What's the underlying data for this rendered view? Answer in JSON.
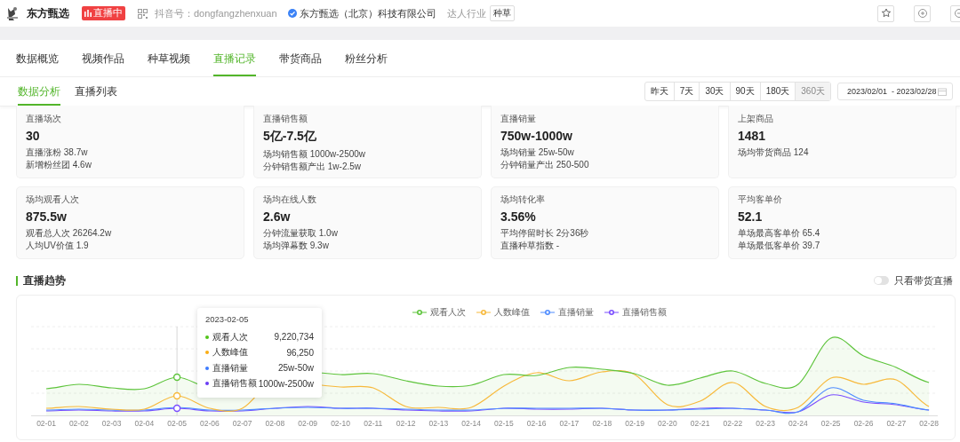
{
  "header": {
    "name": "东方甄选",
    "live_badge": "直播中",
    "douyin_id": "抖音号：dongfangzhenxuan",
    "company": "东方甄选（北京）科技有限公司",
    "industry_label": "达人行业",
    "industry_tag": "种草"
  },
  "tabs": [
    {
      "label": "数据概览",
      "selected": false
    },
    {
      "label": "视频作品",
      "selected": false
    },
    {
      "label": "种草视频",
      "selected": false
    },
    {
      "label": "直播记录",
      "selected": true
    },
    {
      "label": "带货商品",
      "selected": false
    },
    {
      "label": "粉丝分析",
      "selected": false
    }
  ],
  "subtabs": [
    {
      "label": "数据分析",
      "selected": true
    },
    {
      "label": "直播列表",
      "selected": false
    }
  ],
  "periods": [
    {
      "label": "昨天",
      "selected": false
    },
    {
      "label": "7天",
      "selected": false
    },
    {
      "label": "30天",
      "selected": false
    },
    {
      "label": "90天",
      "selected": false
    },
    {
      "label": "180天",
      "selected": false
    },
    {
      "label": "360天",
      "selected": true
    }
  ],
  "date_range": "2023/02/01  - 2023/02/28",
  "metrics": [
    {
      "title": "直播场次",
      "value": "30",
      "details": [
        "直播涨粉 38.7w",
        "新增粉丝团 4.6w"
      ]
    },
    {
      "title": "直播销售额",
      "value": "5亿-7.5亿",
      "details": [
        "场均销售额 1000w-2500w",
        "分钟销售额产出 1w-2.5w"
      ]
    },
    {
      "title": "直播销量",
      "value": "750w-1000w",
      "details": [
        "场均销量 25w-50w",
        "分钟销量产出 250-500"
      ]
    },
    {
      "title": "上架商品",
      "value": "1481",
      "details": [
        "场均带货商品 124"
      ]
    },
    {
      "title": "场均观看人次",
      "value": "875.5w",
      "details": [
        "观看总人次 26264.2w",
        "人均UV价值 1.9"
      ]
    },
    {
      "title": "场均在线人数",
      "value": "2.6w",
      "details": [
        "分钟流量获取 1.0w",
        "场均弹幕数 9.3w"
      ]
    },
    {
      "title": "场均转化率",
      "value": "3.56%",
      "details": [
        "平均停留时长 2分36秒",
        "直播种草指数 -"
      ]
    },
    {
      "title": "平均客单价",
      "value": "52.1",
      "details": [
        "单场最高客单价 65.4",
        "单场最低客单价 39.7"
      ]
    }
  ],
  "trend": {
    "title": "直播趋势",
    "toggle": {
      "label": "只看带货直播",
      "on": false
    },
    "legend": [
      {
        "name": "观看人次",
        "color": "#5ec43c"
      },
      {
        "name": "人数峰值",
        "color": "#f7b93b"
      },
      {
        "name": "直播销量",
        "color": "#4e8cff"
      },
      {
        "name": "直播销售额",
        "color": "#7a4dff"
      }
    ],
    "x_labels": [
      "02-01",
      "02-02",
      "02-03",
      "02-04",
      "02-05",
      "02-06",
      "02-07",
      "02-08",
      "02-09",
      "02-10",
      "02-11",
      "02-12",
      "02-13",
      "02-14",
      "02-15",
      "02-16",
      "02-17",
      "02-18",
      "02-19",
      "02-20",
      "02-21",
      "02-22",
      "02-23",
      "02-24",
      "02-25",
      "02-26",
      "02-27",
      "02-28"
    ],
    "tooltip": {
      "date": "2023-02-05",
      "rows": [
        {
          "label": "观看人次",
          "value": "9,220,734",
          "color": "#52c41a"
        },
        {
          "label": "人数峰值",
          "value": "96,250",
          "color": "#faad14"
        },
        {
          "label": "直播销量",
          "value": "25w-50w",
          "color": "#3d7bff"
        },
        {
          "label": "直播销售额",
          "value": "1000w-2500w",
          "color": "#6a3df5"
        }
      ]
    }
  }
}
